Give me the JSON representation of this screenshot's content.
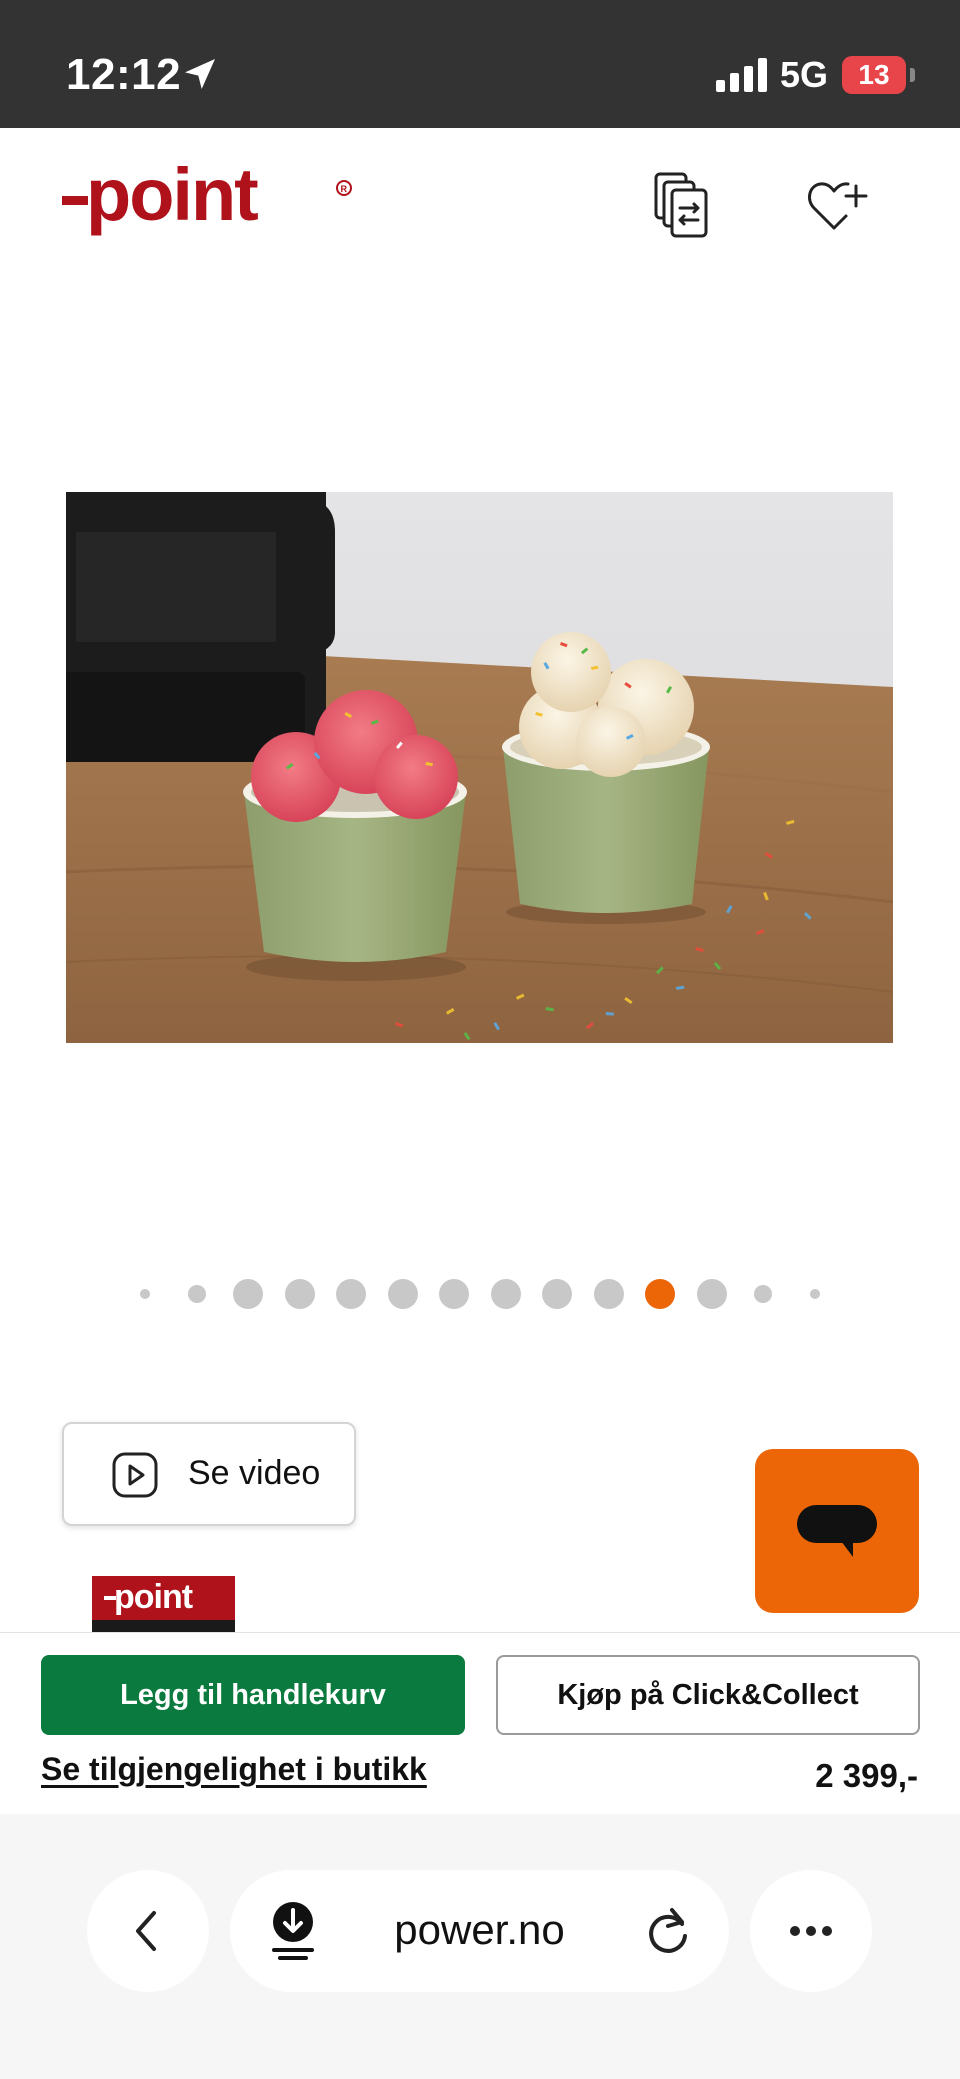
{
  "status_bar": {
    "time": "12:12",
    "network": "5G",
    "battery": "13"
  },
  "header": {
    "logo_text": "point",
    "logo_color": "#b0121b",
    "icons": [
      "compare-icon",
      "wishlist-add-icon"
    ]
  },
  "product": {
    "image_description_icon": "product-photo",
    "carousel": {
      "total_dots": 14,
      "active_index": 10,
      "accent": "#ec6608"
    }
  },
  "video_button": {
    "label": "Se video"
  },
  "brand_badge": {
    "text": "point"
  },
  "purchase": {
    "add_to_cart_label": "Legg til handlekurv",
    "click_collect_label": "Kjøp på Click&Collect",
    "availability_link": "Se tilgjengelighet i butikk",
    "price": "2 399,-",
    "primary_color": "#0b7a3e"
  },
  "browser": {
    "url": "power.no"
  }
}
